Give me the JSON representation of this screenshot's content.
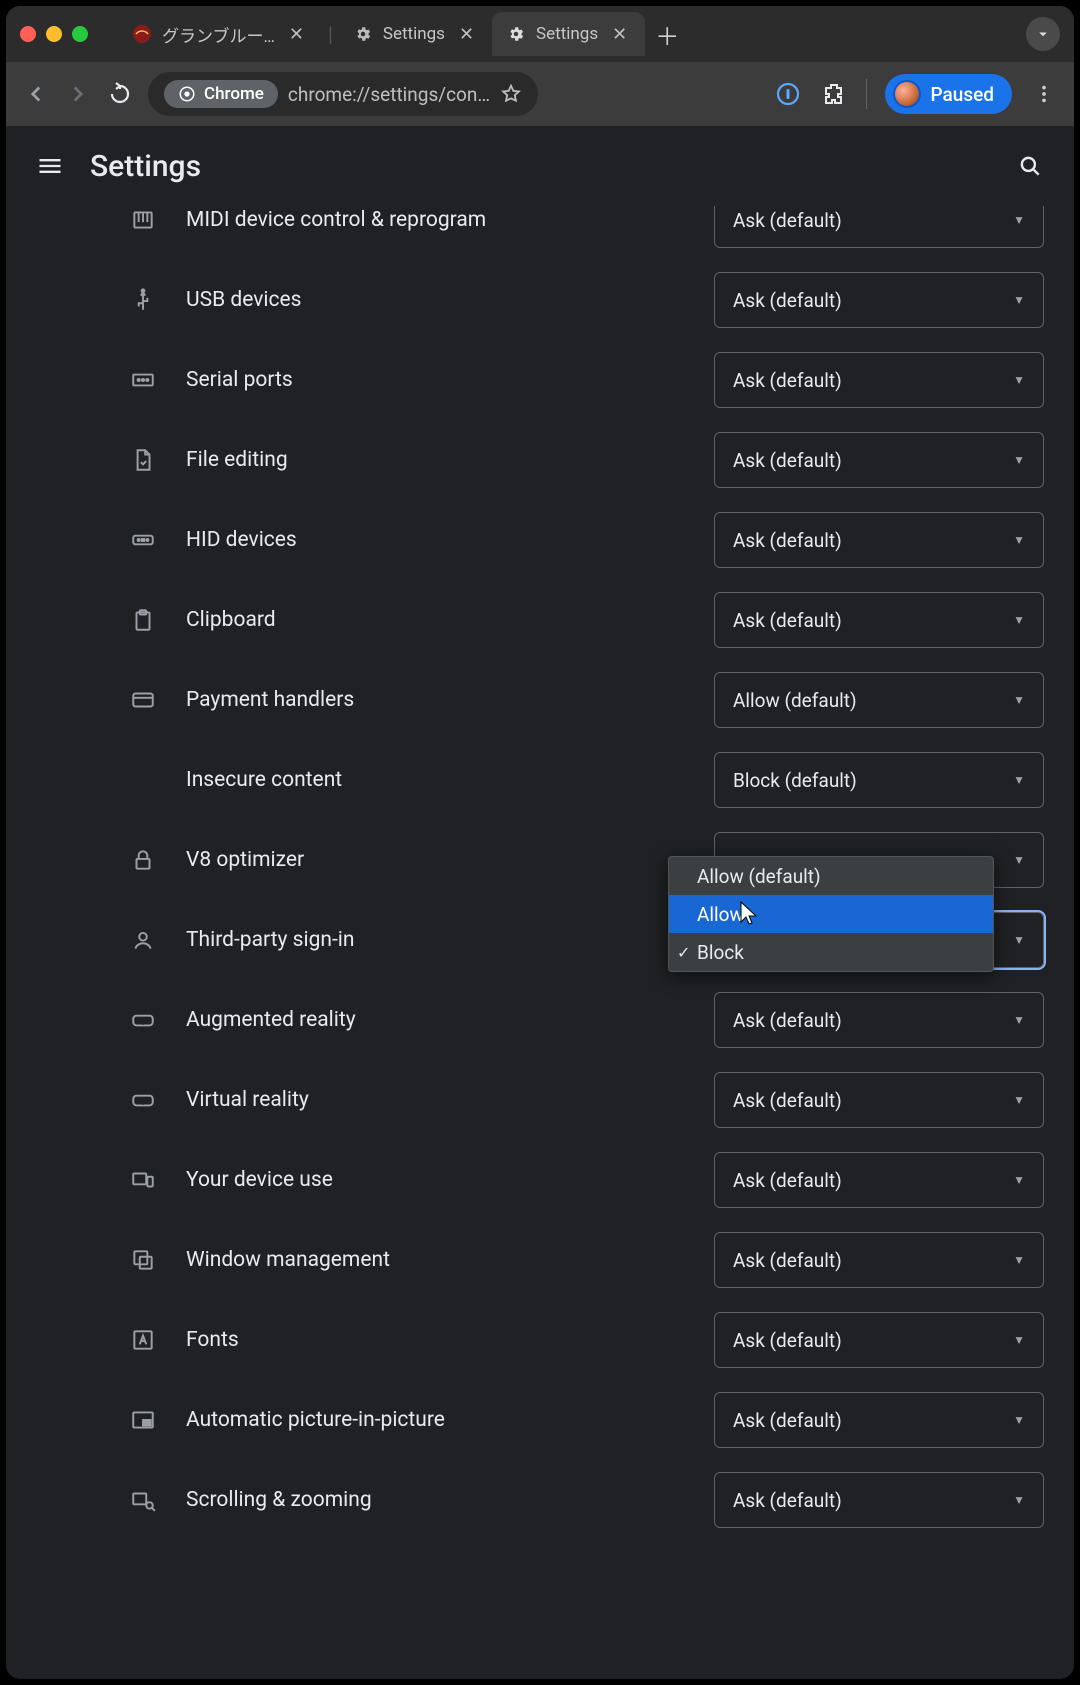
{
  "tabs": [
    {
      "title": "グランブルー…",
      "active": false
    },
    {
      "title": "Settings",
      "active": false
    },
    {
      "title": "Settings",
      "active": true
    }
  ],
  "toolbar": {
    "chrome_chip": "Chrome",
    "url": "chrome://settings/con…",
    "paused_label": "Paused"
  },
  "header": {
    "title": "Settings"
  },
  "dropdown": {
    "options": [
      "Allow (default)",
      "Allow",
      "Block"
    ],
    "hover_index": 1,
    "checked_index": 2
  },
  "permissions": [
    {
      "icon": "midi",
      "label": "MIDI device control & reprogram",
      "value": "Ask (default)"
    },
    {
      "icon": "usb",
      "label": "USB devices",
      "value": "Ask (default)"
    },
    {
      "icon": "serial",
      "label": "Serial ports",
      "value": "Ask (default)"
    },
    {
      "icon": "file",
      "label": "File editing",
      "value": "Ask (default)"
    },
    {
      "icon": "hid",
      "label": "HID devices",
      "value": "Ask (default)"
    },
    {
      "icon": "clipboard",
      "label": "Clipboard",
      "value": "Ask (default)"
    },
    {
      "icon": "payment",
      "label": "Payment handlers",
      "value": "Allow (default)"
    },
    {
      "icon": "warning",
      "label": "Insecure content",
      "value": "Block (default)"
    },
    {
      "icon": "lock",
      "label": "V8 optimizer",
      "value": ""
    },
    {
      "icon": "person",
      "label": "Third-party sign-in",
      "value": "",
      "focused": true
    },
    {
      "icon": "vr",
      "label": "Augmented reality",
      "value": "Ask (default)"
    },
    {
      "icon": "vr",
      "label": "Virtual reality",
      "value": "Ask (default)"
    },
    {
      "icon": "devices",
      "label": "Your device use",
      "value": "Ask (default)"
    },
    {
      "icon": "window",
      "label": "Window management",
      "value": "Ask (default)"
    },
    {
      "icon": "font",
      "label": "Fonts",
      "value": "Ask (default)"
    },
    {
      "icon": "pip",
      "label": "Automatic picture-in-picture",
      "value": "Ask (default)"
    },
    {
      "icon": "zoom",
      "label": "Scrolling & zooming",
      "value": "Ask (default)"
    }
  ]
}
